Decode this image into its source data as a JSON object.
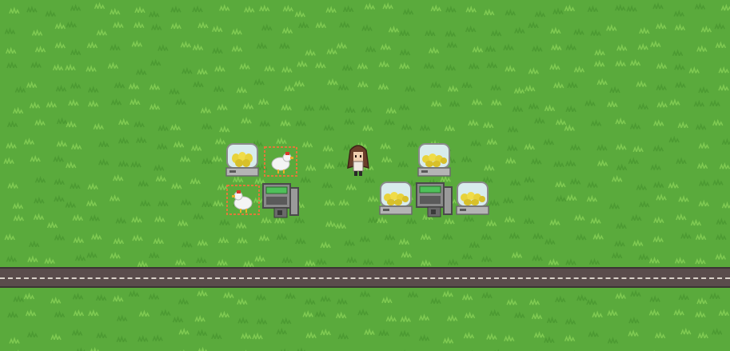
{
  "scene": {
    "title": "",
    "colors": {
      "grass": "#5aaa3c",
      "grass_tuft": "#4c9a32",
      "grass_light": "#7fca52",
      "road": "#5a4c4c",
      "road_line": "#d8d0c8",
      "pen_border": "#e07a3a",
      "incubator_frame": "#9a9a9a",
      "egg_yellow": "#e8d23a",
      "machine_screen": "#4fc05a"
    }
  },
  "entities": [
    {
      "kind": "incubator",
      "name": "incubator-1"
    },
    {
      "kind": "chicken-pen",
      "name": "chicken-pen-1"
    },
    {
      "kind": "chicken-pen",
      "name": "chicken-pen-2"
    },
    {
      "kind": "cash-machine",
      "name": "cash-machine-1"
    },
    {
      "kind": "player",
      "name": "player-character"
    },
    {
      "kind": "incubator",
      "name": "incubator-2"
    },
    {
      "kind": "incubator",
      "name": "incubator-3"
    },
    {
      "kind": "cash-machine",
      "name": "cash-machine-2"
    },
    {
      "kind": "incubator",
      "name": "incubator-4"
    }
  ]
}
